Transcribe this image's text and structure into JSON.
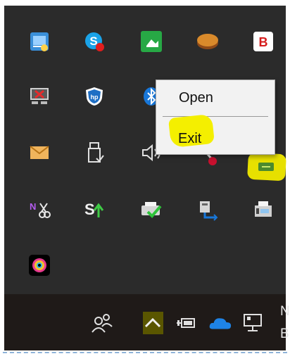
{
  "context_menu": {
    "items": [
      {
        "label": "Open"
      },
      {
        "label": "Exit"
      }
    ]
  },
  "tray_icons": [
    "network-app-icon",
    "skype-icon",
    "green-app-icon",
    "database-app-icon",
    "b-app-icon",
    "network-disconnected-icon",
    "security-shield-icon",
    "bluetooth-icon",
    "mail-icon",
    "usb-safely-remove-icon",
    "volume-icon",
    "snipping-tool-icon",
    "highlighted-tray-icon",
    "onenote-clip-icon",
    "sync-up-icon",
    "printer-ok-icon",
    "printer-network-icon",
    "fax-printer-icon",
    "camera-app-icon"
  ],
  "taskbar": {
    "icons": [
      "people-icon",
      "show-hidden-icons-chevron",
      "power-plug-icon",
      "onedrive-icon",
      "network-monitor-icon"
    ],
    "clipped_text_top": "N",
    "clipped_text_bottom": "B"
  },
  "colors": {
    "tray_bg": "#2b2b2b",
    "taskbar_bg": "#1f1a18",
    "highlight": "#f4ef00",
    "menu_bg": "#f2f2f2"
  }
}
